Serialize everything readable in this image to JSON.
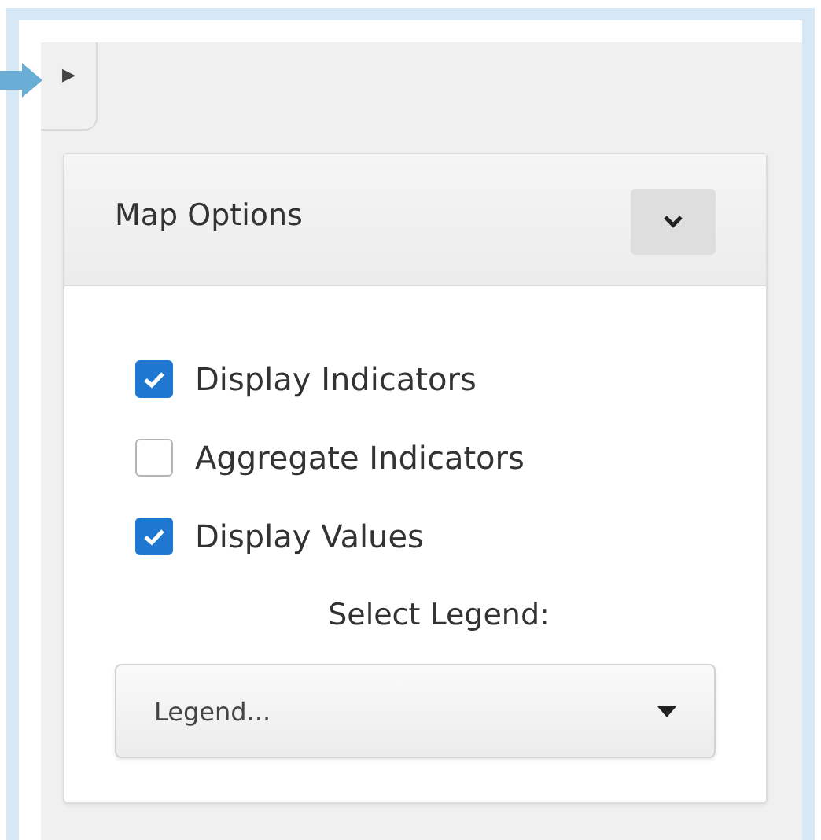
{
  "panel_toggle": {
    "icon": "▶"
  },
  "panel": {
    "title": "Map Options",
    "expanded": true,
    "options": [
      {
        "label": "Display Indicators",
        "checked": true
      },
      {
        "label": "Aggregate Indicators",
        "checked": false
      },
      {
        "label": "Display Values",
        "checked": true
      }
    ],
    "legend_label": "Select Legend:",
    "legend_select": {
      "value": "Legend..."
    }
  }
}
